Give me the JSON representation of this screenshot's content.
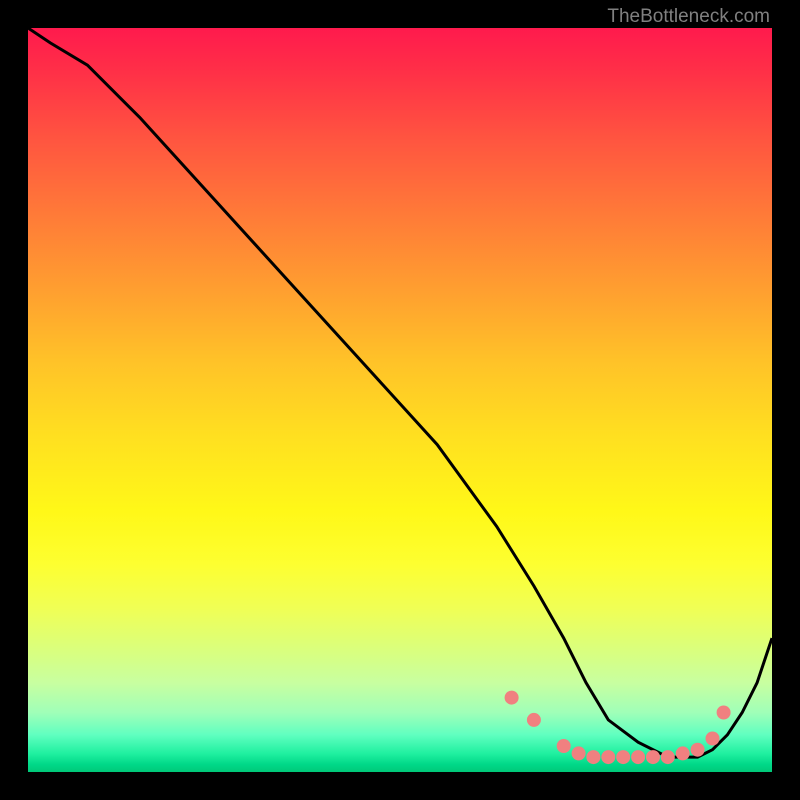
{
  "watermark": "TheBottleneck.com",
  "chart_data": {
    "type": "line",
    "title": "",
    "xlabel": "",
    "ylabel": "",
    "xlim": [
      0,
      100
    ],
    "ylim": [
      0,
      100
    ],
    "series": [
      {
        "name": "curve",
        "x": [
          0,
          3,
          8,
          15,
          25,
          35,
          45,
          55,
          63,
          68,
          72,
          75,
          78,
          82,
          86,
          90,
          92,
          94,
          96,
          98,
          100
        ],
        "y": [
          100,
          98,
          95,
          88,
          77,
          66,
          55,
          44,
          33,
          25,
          18,
          12,
          7,
          4,
          2,
          2,
          3,
          5,
          8,
          12,
          18
        ]
      }
    ],
    "markers": {
      "name": "dots",
      "x": [
        65,
        68,
        72,
        74,
        76,
        78,
        80,
        82,
        84,
        86,
        88,
        90,
        92,
        93.5
      ],
      "y": [
        10,
        7,
        3.5,
        2.5,
        2,
        2,
        2,
        2,
        2,
        2,
        2.5,
        3,
        4.5,
        8
      ]
    },
    "gradient_stops": [
      {
        "pos": 0,
        "color": "#ff1a4d"
      },
      {
        "pos": 50,
        "color": "#ffe020"
      },
      {
        "pos": 80,
        "color": "#fdff30"
      },
      {
        "pos": 100,
        "color": "#00c878"
      }
    ]
  }
}
